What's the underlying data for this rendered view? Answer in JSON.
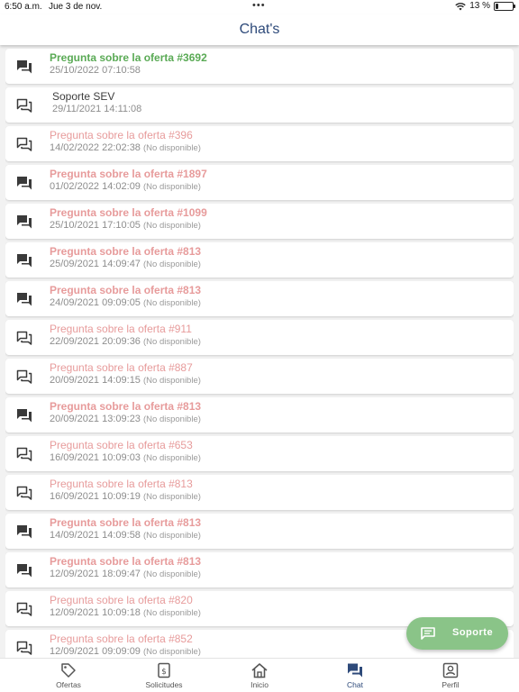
{
  "status_bar": {
    "time": "6:50 a.m.",
    "date": "Jue 3 de nov.",
    "dots": "•••",
    "battery": "13 %"
  },
  "header": {
    "title": "Chat's"
  },
  "chats": [
    {
      "title": "Pregunta sobre la oferta #3692",
      "date": "25/10/2022 07:10:58",
      "status": "",
      "style": "green",
      "icon": "chat-bubble-filled-icon"
    },
    {
      "title": "Soporte SEV",
      "date": "29/11/2021 14:11:08",
      "status": "",
      "style": "dark",
      "icon": "chat-bubbles-outline-icon"
    },
    {
      "title": "Pregunta sobre la oferta #396",
      "date": "14/02/2022 22:02:38",
      "status": "(No disponible)",
      "style": "red",
      "icon": "chat-bubbles-outline-icon"
    },
    {
      "title": "Pregunta sobre la oferta #1897",
      "date": "01/02/2022 14:02:09",
      "status": "(No disponible)",
      "style": "red-bold",
      "icon": "chat-bubble-filled-icon"
    },
    {
      "title": "Pregunta sobre la oferta #1099",
      "date": "25/10/2021 17:10:05",
      "status": "(No disponible)",
      "style": "red-bold",
      "icon": "chat-bubble-filled-icon"
    },
    {
      "title": "Pregunta sobre la oferta #813",
      "date": "25/09/2021 14:09:47",
      "status": "(No disponible)",
      "style": "red-bold",
      "icon": "chat-bubble-filled-icon"
    },
    {
      "title": "Pregunta sobre la oferta #813",
      "date": "24/09/2021 09:09:05",
      "status": "(No disponible)",
      "style": "red-bold",
      "icon": "chat-bubble-filled-icon"
    },
    {
      "title": "Pregunta sobre la oferta #911",
      "date": "22/09/2021 20:09:36",
      "status": "(No disponible)",
      "style": "red",
      "icon": "chat-bubbles-outline-icon"
    },
    {
      "title": "Pregunta sobre la oferta #887",
      "date": "20/09/2021 14:09:15",
      "status": "(No disponible)",
      "style": "red",
      "icon": "chat-bubbles-outline-icon"
    },
    {
      "title": "Pregunta sobre la oferta #813",
      "date": "20/09/2021 13:09:23",
      "status": "(No disponible)",
      "style": "red-bold",
      "icon": "chat-bubble-filled-icon"
    },
    {
      "title": "Pregunta sobre la oferta #653",
      "date": "16/09/2021 10:09:03",
      "status": "(No disponible)",
      "style": "red",
      "icon": "chat-bubbles-outline-icon"
    },
    {
      "title": "Pregunta sobre la oferta #813",
      "date": "16/09/2021 10:09:19",
      "status": "(No disponible)",
      "style": "red",
      "icon": "chat-bubbles-outline-icon"
    },
    {
      "title": "Pregunta sobre la oferta #813",
      "date": "14/09/2021 14:09:58",
      "status": "(No disponible)",
      "style": "red-bold",
      "icon": "chat-bubble-filled-icon"
    },
    {
      "title": "Pregunta sobre la oferta #813",
      "date": "12/09/2021 18:09:47",
      "status": "(No disponible)",
      "style": "red-bold",
      "icon": "chat-bubble-filled-icon"
    },
    {
      "title": "Pregunta sobre la oferta #820",
      "date": "12/09/2021 10:09:18",
      "status": "(No disponible)",
      "style": "red",
      "icon": "chat-bubbles-outline-icon"
    },
    {
      "title": "Pregunta sobre la oferta #852",
      "date": "12/09/2021 09:09:09",
      "status": "(No disponible)",
      "style": "red",
      "icon": "chat-bubbles-outline-icon"
    }
  ],
  "fab": {
    "label": "Soporte"
  },
  "bottom_nav": [
    {
      "label": "Ofertas",
      "icon": "tag-icon",
      "active": false
    },
    {
      "label": "Solicitudes",
      "icon": "receipt-icon",
      "active": false
    },
    {
      "label": "Inicio",
      "icon": "home-icon",
      "active": false
    },
    {
      "label": "Chat",
      "icon": "chat-icon",
      "active": true
    },
    {
      "label": "Perfil",
      "icon": "profile-icon",
      "active": false
    }
  ],
  "colors": {
    "title_blue": "#2e4a7a",
    "green": "#5aaa55",
    "unavailable_red": "#e79b9b",
    "fab_green": "#8ac488"
  }
}
